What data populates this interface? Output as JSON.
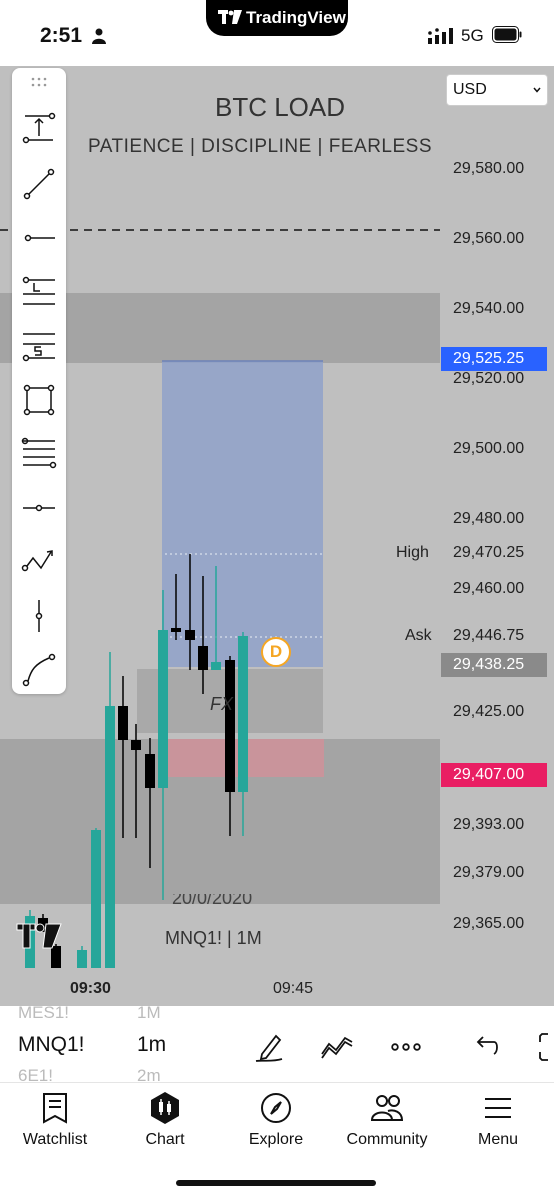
{
  "status_bar": {
    "time": "2:51",
    "network": "5G"
  },
  "brand": {
    "name": "TradingView"
  },
  "chart": {
    "title": "BTC LOAD",
    "subtitle": "PATIENCE | DISCIPLINE | FEARLESS",
    "currency": "USD",
    "price_labels": [
      "29,580.00",
      "29,560.00",
      "29,540.00",
      "29,520.00",
      "29,500.00",
      "29,480.00",
      "29,470.25",
      "29,460.00",
      "29,446.75",
      "29,425.00",
      "29,393.00",
      "29,379.00",
      "29,365.00"
    ],
    "price_tags": [
      {
        "value": "29,525.25",
        "color": "#2962ff"
      },
      {
        "value": "29,438.25",
        "color": "#8a8a8a"
      },
      {
        "value": "29,407.00",
        "color": "#e91e63"
      }
    ],
    "high_label": "High",
    "ask_label": "Ask",
    "fx_label": "FX",
    "marker_label": "D",
    "symbol_line": "MNQ1! | 1M",
    "date_line": "20/0/2020",
    "time_labels": [
      "09:30",
      "09:45"
    ],
    "colors": {
      "up": "#26a69a",
      "down": "#000000",
      "zone_blue": "#8fa1c9",
      "zone_pink": "#c9949b"
    }
  },
  "symbol_bar": {
    "ghost_symbols": [
      "MES1!",
      "6E1!"
    ],
    "ghost_timeframes": [
      "1M",
      "2m"
    ],
    "symbol": "MNQ1!",
    "timeframe": "1m",
    "icons": [
      "pen-icon",
      "indicators-icon",
      "more-icon",
      "undo-icon",
      "fullscreen-icon"
    ]
  },
  "tabs": [
    {
      "label": "Watchlist",
      "icon": "watchlist-icon"
    },
    {
      "label": "Chart",
      "icon": "chart-icon"
    },
    {
      "label": "Explore",
      "icon": "compass-icon"
    },
    {
      "label": "Community",
      "icon": "community-icon"
    },
    {
      "label": "Menu",
      "icon": "menu-icon"
    }
  ]
}
